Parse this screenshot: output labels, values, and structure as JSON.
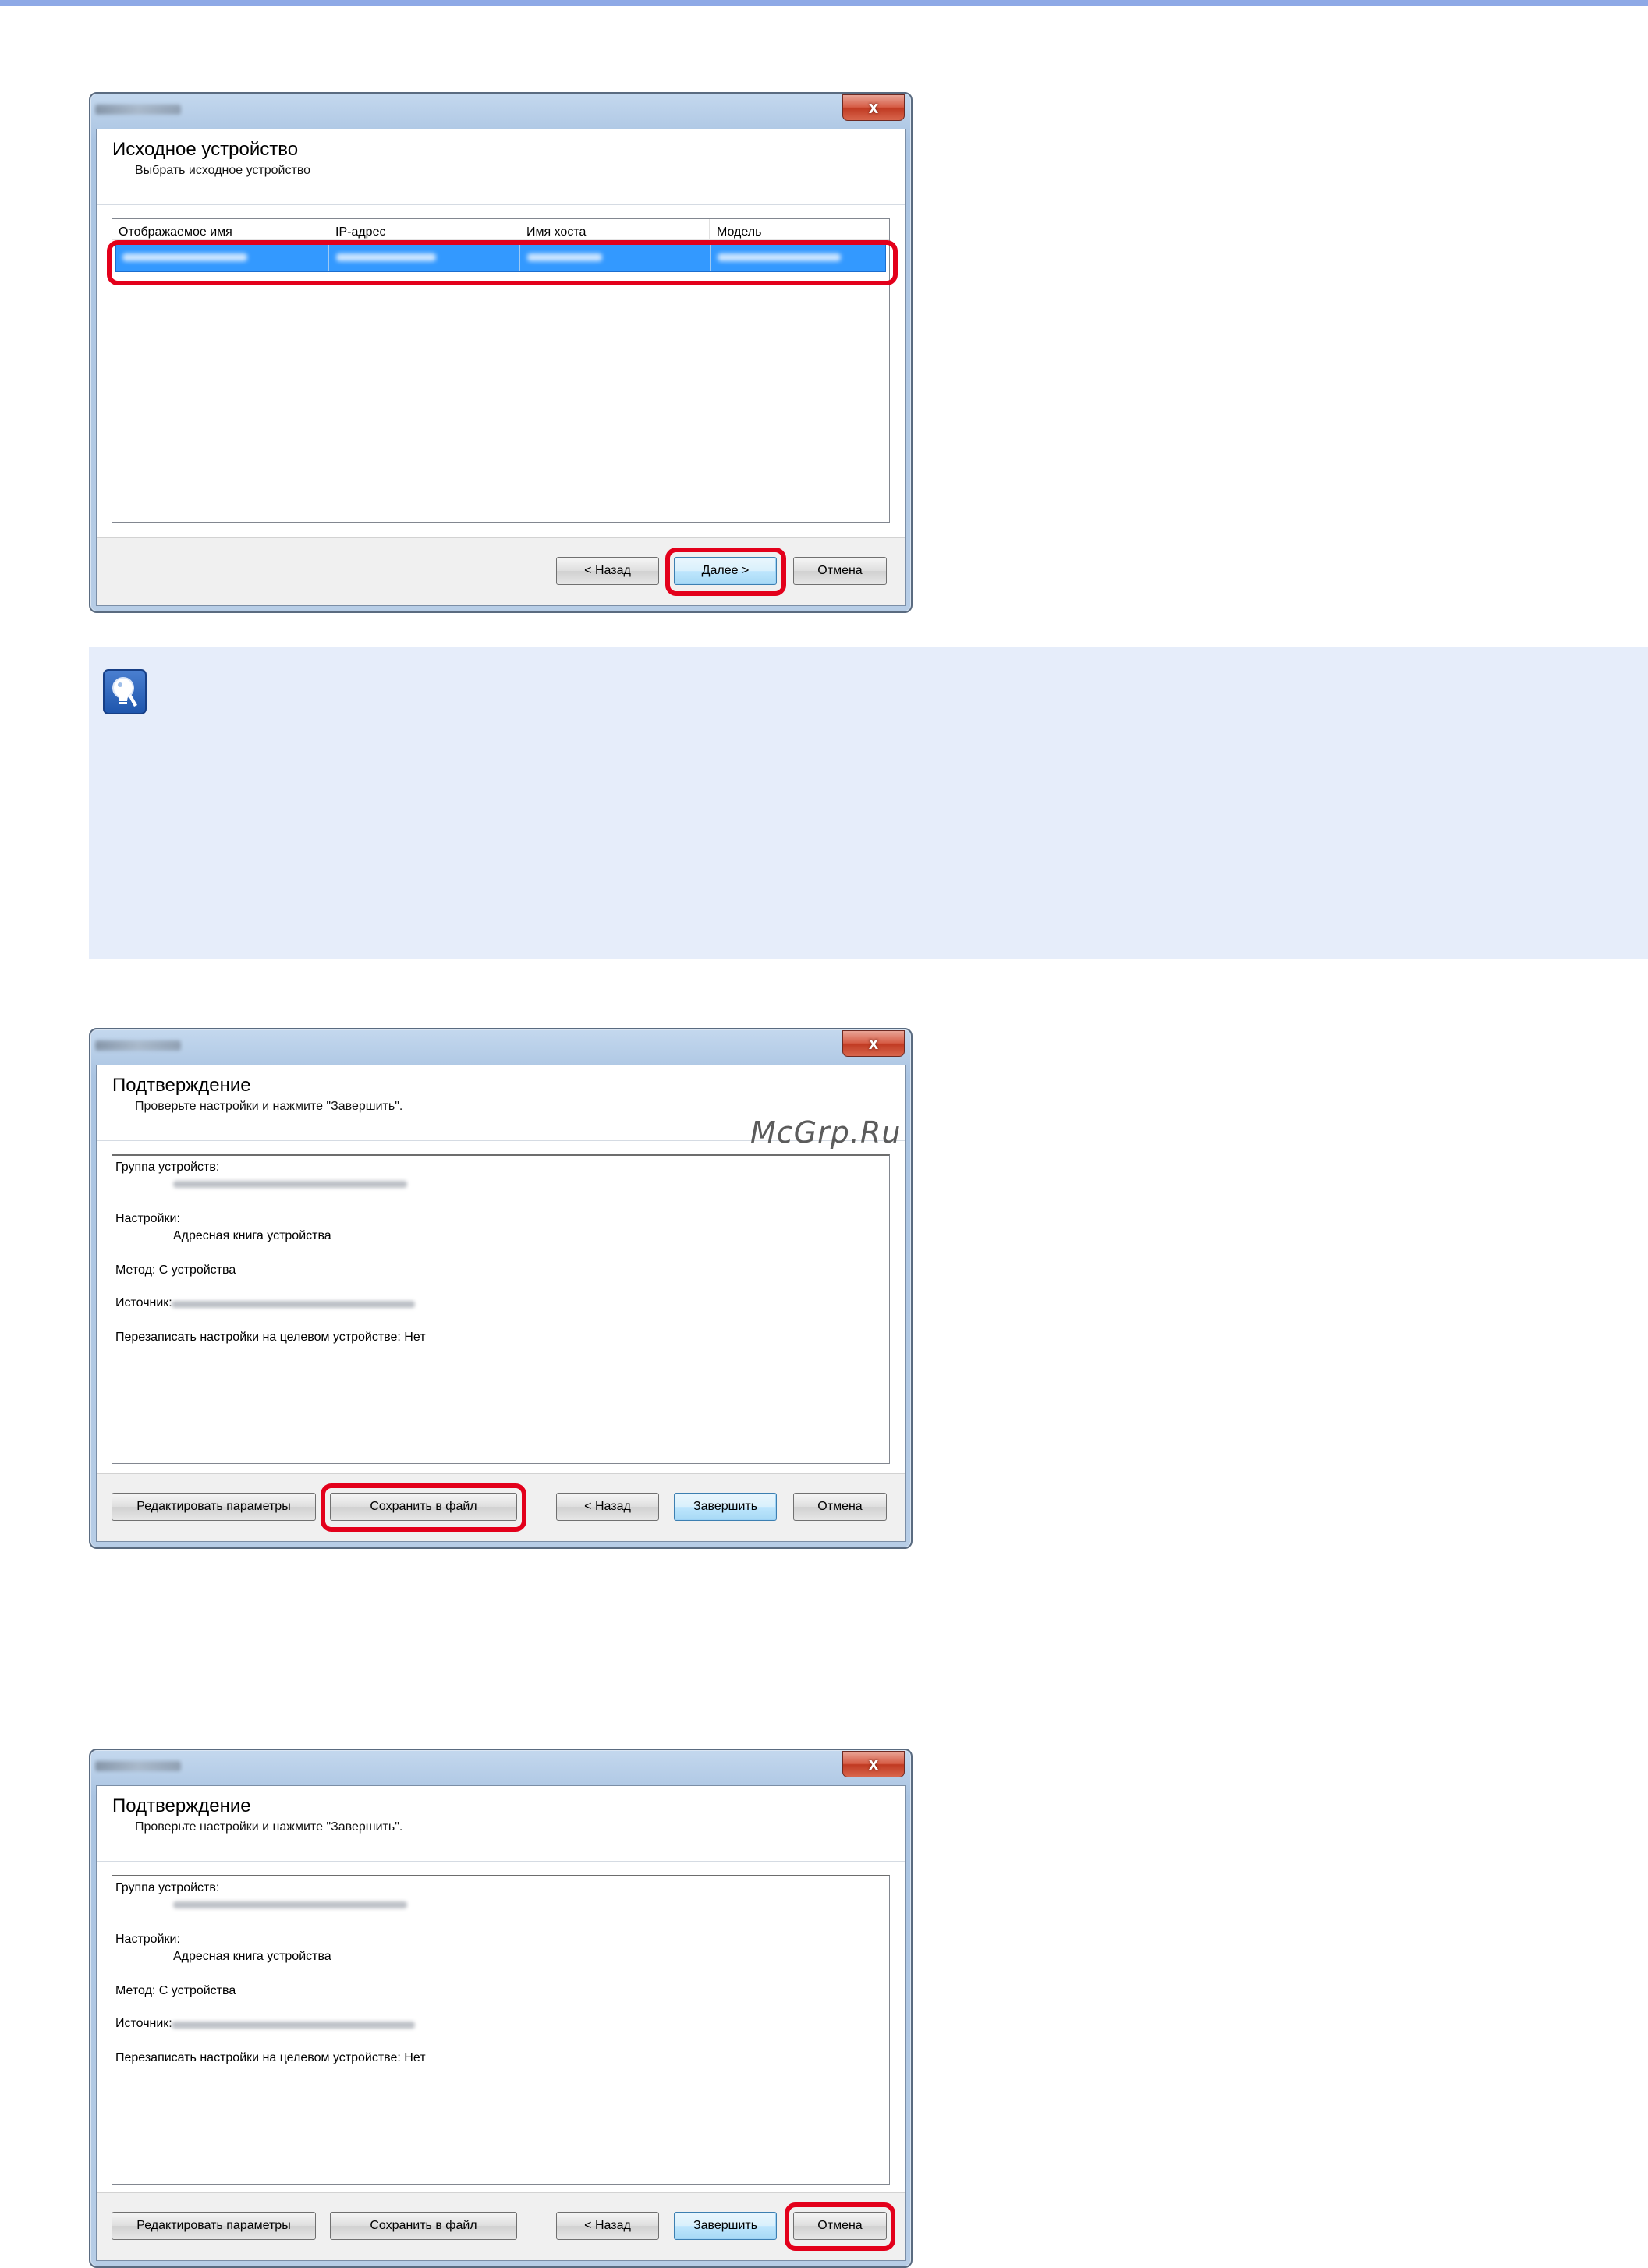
{
  "window1": {
    "close_glyph": "x",
    "header_title": "Исходное устройство",
    "header_subtitle": "Выбрать исходное устройство",
    "list_columns": [
      "Отображаемое имя",
      "IP-адрес",
      "Имя хоста",
      "Модель"
    ],
    "buttons": {
      "back": "< Назад",
      "next": "Далее >",
      "cancel": "Отмена"
    }
  },
  "window2": {
    "close_glyph": "x",
    "header_title": "Подтверждение",
    "header_subtitle": "Проверьте настройки и нажмите \"Завершить\".",
    "summary": {
      "device_group_label": "Группа устройств:",
      "settings_label": "Настройки:",
      "settings_value": "Адресная книга устройства",
      "method_line": "Метод: С устройства",
      "source_label": "Источник:",
      "overwrite_line": "Перезаписать настройки на целевом устройстве: Нет"
    },
    "buttons": {
      "edit": "Редактировать параметры",
      "save": "Сохранить в файл",
      "back": "< Назад",
      "finish": "Завершить",
      "cancel": "Отмена"
    }
  },
  "window3": {
    "close_glyph": "x",
    "header_title": "Подтверждение",
    "header_subtitle": "Проверьте настройки и нажмите \"Завершить\".",
    "summary": {
      "device_group_label": "Группа устройств:",
      "settings_label": "Настройки:",
      "settings_value": "Адресная книга устройства",
      "method_line": "Метод: С устройства",
      "source_label": "Источник:",
      "overwrite_line": "Перезаписать настройки на целевом устройстве: Нет"
    },
    "buttons": {
      "edit": "Редактировать параметры",
      "save": "Сохранить в файл",
      "back": "< Назад",
      "finish": "Завершить",
      "cancel": "Отмена"
    }
  },
  "note": {
    "icon": "lightbulb-icon"
  },
  "watermark": "McGrp.Ru",
  "colors": {
    "highlight": "#e3001b",
    "selection": "#3399ff",
    "note_background": "#e6edfa",
    "top_bar": "#8ea9e6"
  }
}
